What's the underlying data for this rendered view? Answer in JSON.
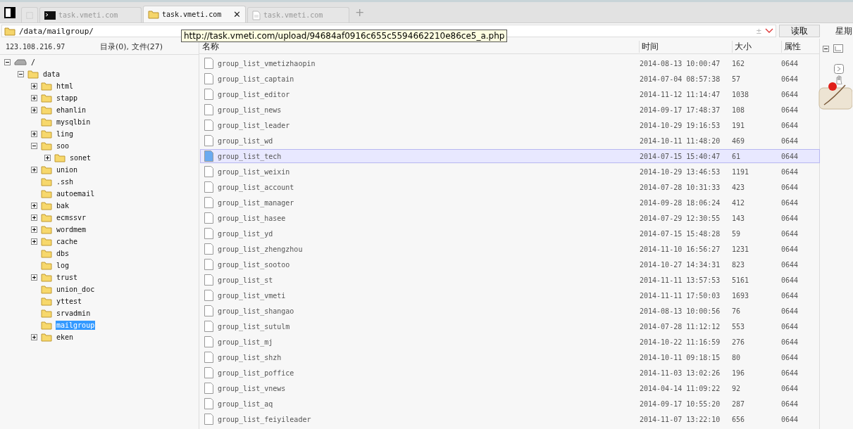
{
  "tabs": [
    {
      "kind": "blank",
      "selected": false
    },
    {
      "kind": "terminal",
      "label": "task.vmeti.com",
      "selected": false
    },
    {
      "kind": "folder",
      "label": "task.vmeti.com",
      "selected": true,
      "close": "✕"
    },
    {
      "kind": "document",
      "label": "task.vmeti.com",
      "selected": false
    }
  ],
  "new_tab": "+",
  "address": {
    "value": "/data/mailgroup/",
    "plus_minus": "±",
    "button": "读取"
  },
  "tooltip": "http://task.vmeti.com/upload/94684af0916c655c5594662210e86ce5_a.php",
  "server": "123.108.216.97",
  "summary": "目录(0), 文件(27)",
  "tree": [
    {
      "name": "/",
      "kind": "drive",
      "expanded": true,
      "selected": false,
      "children": [
        {
          "name": "data",
          "kind": "folder",
          "expanded": true,
          "selected": false,
          "children": [
            {
              "name": "html",
              "kind": "folder",
              "expanded": false,
              "selected": false
            },
            {
              "name": "stapp",
              "kind": "folder",
              "expanded": false,
              "selected": false
            },
            {
              "name": "ehanlin",
              "kind": "folder",
              "expanded": false,
              "selected": false
            },
            {
              "name": "mysqlbin",
              "kind": "folder",
              "selected": false
            },
            {
              "name": "ling",
              "kind": "folder",
              "expanded": false,
              "selected": false
            },
            {
              "name": "soo",
              "kind": "folder",
              "expanded": true,
              "selected": false,
              "children": [
                {
                  "name": "sonet",
                  "kind": "folder",
                  "expanded": false,
                  "selected": false
                }
              ]
            },
            {
              "name": "union",
              "kind": "folder",
              "expanded": false,
              "selected": false
            },
            {
              "name": ".ssh",
              "kind": "folder",
              "selected": false
            },
            {
              "name": "autoemail",
              "kind": "folder",
              "selected": false
            },
            {
              "name": "bak",
              "kind": "folder",
              "expanded": false,
              "selected": false
            },
            {
              "name": "ecmssvr",
              "kind": "folder",
              "expanded": false,
              "selected": false
            },
            {
              "name": "wordmem",
              "kind": "folder",
              "expanded": false,
              "selected": false
            },
            {
              "name": "cache",
              "kind": "folder",
              "expanded": false,
              "selected": false
            },
            {
              "name": "dbs",
              "kind": "folder",
              "selected": false
            },
            {
              "name": "log",
              "kind": "folder",
              "selected": false
            },
            {
              "name": "trust",
              "kind": "folder",
              "expanded": false,
              "selected": false
            },
            {
              "name": "union_doc",
              "kind": "folder",
              "selected": false
            },
            {
              "name": "yttest",
              "kind": "folder",
              "selected": false
            },
            {
              "name": "srvadmin",
              "kind": "folder",
              "selected": false
            },
            {
              "name": "mailgroup",
              "kind": "folder",
              "selected": true
            },
            {
              "name": "eken",
              "kind": "folder",
              "expanded": false,
              "selected": false
            }
          ]
        }
      ]
    }
  ],
  "table": {
    "columns": [
      "名称",
      "时间",
      "大小",
      "属性"
    ],
    "rows": [
      {
        "name": "group_list_vmetizhaopin",
        "time": "2014-08-13 10:00:47",
        "size": "162",
        "mode": "0644",
        "selected": false
      },
      {
        "name": "group_list_captain",
        "time": "2014-07-04 08:57:38",
        "size": "57",
        "mode": "0644",
        "selected": false
      },
      {
        "name": "group_list_editor",
        "time": "2014-11-12 11:14:47",
        "size": "1038",
        "mode": "0644",
        "selected": false
      },
      {
        "name": "group_list_news",
        "time": "2014-09-17 17:48:37",
        "size": "108",
        "mode": "0644",
        "selected": false
      },
      {
        "name": "group_list_leader",
        "time": "2014-10-29 19:16:53",
        "size": "191",
        "mode": "0644",
        "selected": false
      },
      {
        "name": "group_list_wd",
        "time": "2014-10-11 11:48:20",
        "size": "469",
        "mode": "0644",
        "selected": false
      },
      {
        "name": "group_list_tech",
        "time": "2014-07-15 15:40:47",
        "size": "61",
        "mode": "0644",
        "selected": true
      },
      {
        "name": "group_list_weixin",
        "time": "2014-10-29 13:46:53",
        "size": "1191",
        "mode": "0644",
        "selected": false
      },
      {
        "name": "group_list_account",
        "time": "2014-07-28 10:31:33",
        "size": "423",
        "mode": "0644",
        "selected": false
      },
      {
        "name": "group_list_manager",
        "time": "2014-09-28 18:06:24",
        "size": "412",
        "mode": "0644",
        "selected": false
      },
      {
        "name": "group_list_hasee",
        "time": "2014-07-29 12:30:55",
        "size": "143",
        "mode": "0644",
        "selected": false
      },
      {
        "name": "group_list_yd",
        "time": "2014-07-15 15:48:28",
        "size": "59",
        "mode": "0644",
        "selected": false
      },
      {
        "name": "group_list_zhengzhou",
        "time": "2014-11-10 16:56:27",
        "size": "1231",
        "mode": "0644",
        "selected": false
      },
      {
        "name": "group_list_sootoo",
        "time": "2014-10-27 14:34:31",
        "size": "823",
        "mode": "0644",
        "selected": false
      },
      {
        "name": "group_list_st",
        "time": "2014-11-11 13:57:53",
        "size": "5161",
        "mode": "0644",
        "selected": false
      },
      {
        "name": "group_list_vmeti",
        "time": "2014-11-11 17:50:03",
        "size": "1693",
        "mode": "0644",
        "selected": false
      },
      {
        "name": "group_list_shangao",
        "time": "2014-08-13 10:00:56",
        "size": "76",
        "mode": "0644",
        "selected": false
      },
      {
        "name": "group_list_sutulm",
        "time": "2014-07-28 11:12:12",
        "size": "553",
        "mode": "0644",
        "selected": false
      },
      {
        "name": "group_list_mj",
        "time": "2014-10-22 11:16:59",
        "size": "276",
        "mode": "0644",
        "selected": false
      },
      {
        "name": "group_list_shzh",
        "time": "2014-10-11 09:18:15",
        "size": "80",
        "mode": "0644",
        "selected": false
      },
      {
        "name": "group_list_poffice",
        "time": "2014-11-03 13:02:26",
        "size": "196",
        "mode": "0644",
        "selected": false
      },
      {
        "name": "group_list_vnews",
        "time": "2014-04-14 11:09:22",
        "size": "92",
        "mode": "0644",
        "selected": false
      },
      {
        "name": "group_list_aq",
        "time": "2014-09-17 10:55:20",
        "size": "287",
        "mode": "0644",
        "selected": false
      },
      {
        "name": "group_list_feiyileader",
        "time": "2014-11-07 13:22:10",
        "size": "656",
        "mode": "0644",
        "selected": false
      }
    ]
  },
  "side_panel": {
    "title": "星期"
  }
}
